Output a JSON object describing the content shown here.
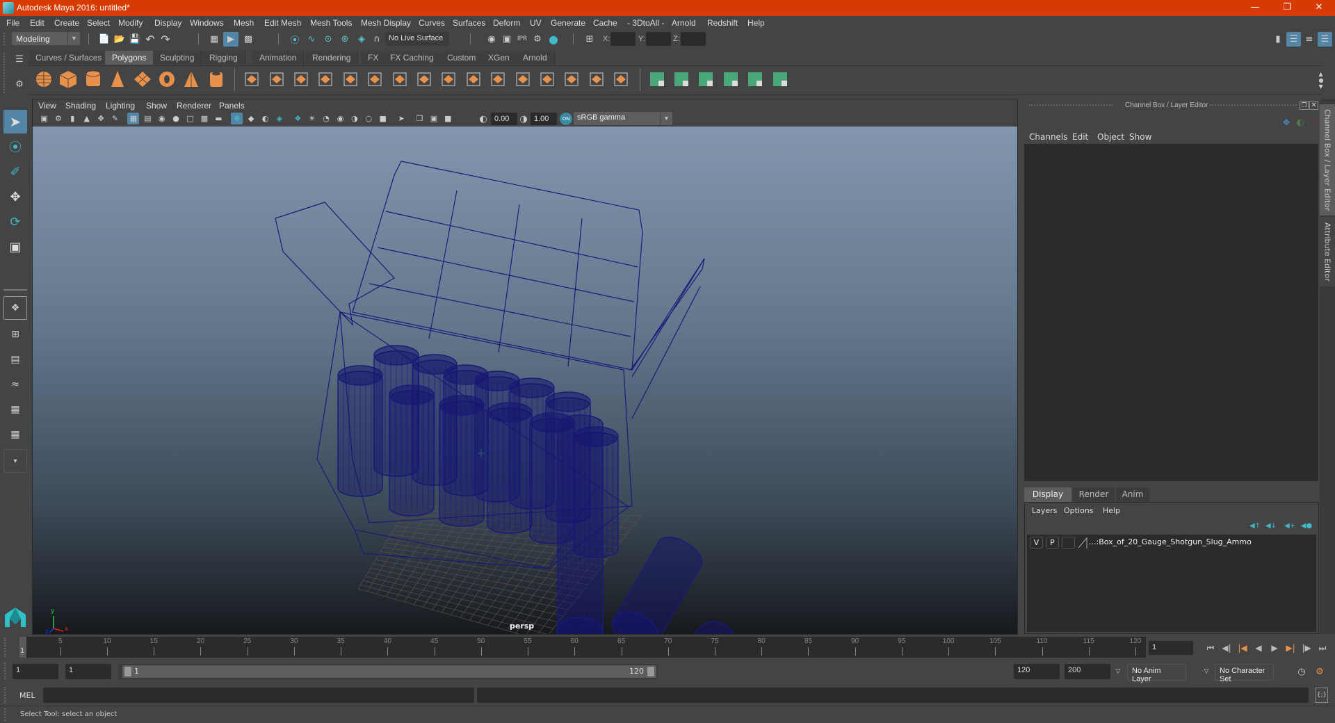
{
  "window": {
    "title": "Autodesk Maya 2016: untitled*",
    "controls": [
      "minimize",
      "restore",
      "close"
    ]
  },
  "menubar": [
    "File",
    "Edit",
    "Create",
    "Select",
    "Modify",
    "Display",
    "Windows",
    "Mesh",
    "Edit Mesh",
    "Mesh Tools",
    "Mesh Display",
    "Curves",
    "Surfaces",
    "Deform",
    "UV",
    "Generate",
    "Cache",
    "- 3DtoAll -",
    "Arnold",
    "Redshift",
    "Help"
  ],
  "statusline": {
    "menuset": "Modeling",
    "live_surface": "No Live Surface",
    "x_label": "X:",
    "y_label": "Y:",
    "z_label": "Z:",
    "x_value": "",
    "y_value": "",
    "z_value": ""
  },
  "shelf": {
    "tabs": [
      "Curves / Surfaces",
      "Polygons",
      "Sculpting",
      "Rigging",
      "Animation",
      "Rendering",
      "FX",
      "FX Caching",
      "Custom",
      "XGen",
      "Arnold"
    ],
    "active_tab": "Polygons",
    "icons": [
      "poly-sphere",
      "poly-cube",
      "poly-cylinder",
      "poly-cone",
      "poly-plane",
      "poly-torus",
      "poly-pyramid",
      "poly-pipe",
      "combine",
      "separate",
      "mirror",
      "smooth",
      "bevel",
      "extrude",
      "bridge",
      "append",
      "target-weld",
      "multi-cut",
      "insert-edge-loop",
      "offset-edge-loop",
      "split",
      "collapse",
      "fill-hole",
      "planar-uv",
      "automatic-uv",
      "cylindrical-uv",
      "spherical-uv",
      "unfold",
      "uv-editor",
      "unitize"
    ]
  },
  "viewport": {
    "menu": [
      "View",
      "Shading",
      "Lighting",
      "Show",
      "Renderer",
      "Panels"
    ],
    "exposure": "0.00",
    "gamma": "1.00",
    "color_space": "sRGB gamma",
    "camera_label": "persp",
    "axis": {
      "x": "x",
      "y": "y",
      "z": "z"
    }
  },
  "channel_box": {
    "title": "Channel Box / Layer Editor",
    "menu": [
      "Channels",
      "Edit",
      "Object",
      "Show"
    ]
  },
  "layer_editor": {
    "tabs": [
      "Display",
      "Render",
      "Anim"
    ],
    "active_tab": "Display",
    "menu": [
      "Layers",
      "Options",
      "Help"
    ],
    "layers": [
      {
        "v": "V",
        "p": "P",
        "name": "...:Box_of_20_Gauge_Shotgun_Slug_Ammo"
      }
    ]
  },
  "side_tabs": [
    "Channel Box / Layer Editor",
    "Attribute Editor"
  ],
  "timeline": {
    "ticks": [
      5,
      10,
      15,
      20,
      25,
      30,
      35,
      40,
      45,
      50,
      55,
      60,
      65,
      70,
      75,
      80,
      85,
      90,
      95,
      100,
      105,
      110,
      115,
      120
    ],
    "start": 1,
    "end": 120,
    "current_frame": "1",
    "current_frame_marker": "1"
  },
  "range": {
    "start_field": "1",
    "playback_start": "1",
    "range_start_label": "1",
    "range_end_label": "120",
    "playback_end": "120",
    "end_field": "200",
    "anim_layer": "No Anim Layer",
    "character_set": "No Character Set"
  },
  "command_line": {
    "label": "MEL",
    "value": ""
  },
  "help_line": "Select Tool: select an object",
  "colors": {
    "titlebar": "#d83b01",
    "accent": "#5285a6",
    "shelf_orange": "#e8914a",
    "shelf_green": "#49a77a",
    "wireframe": "#1a1a7a"
  }
}
